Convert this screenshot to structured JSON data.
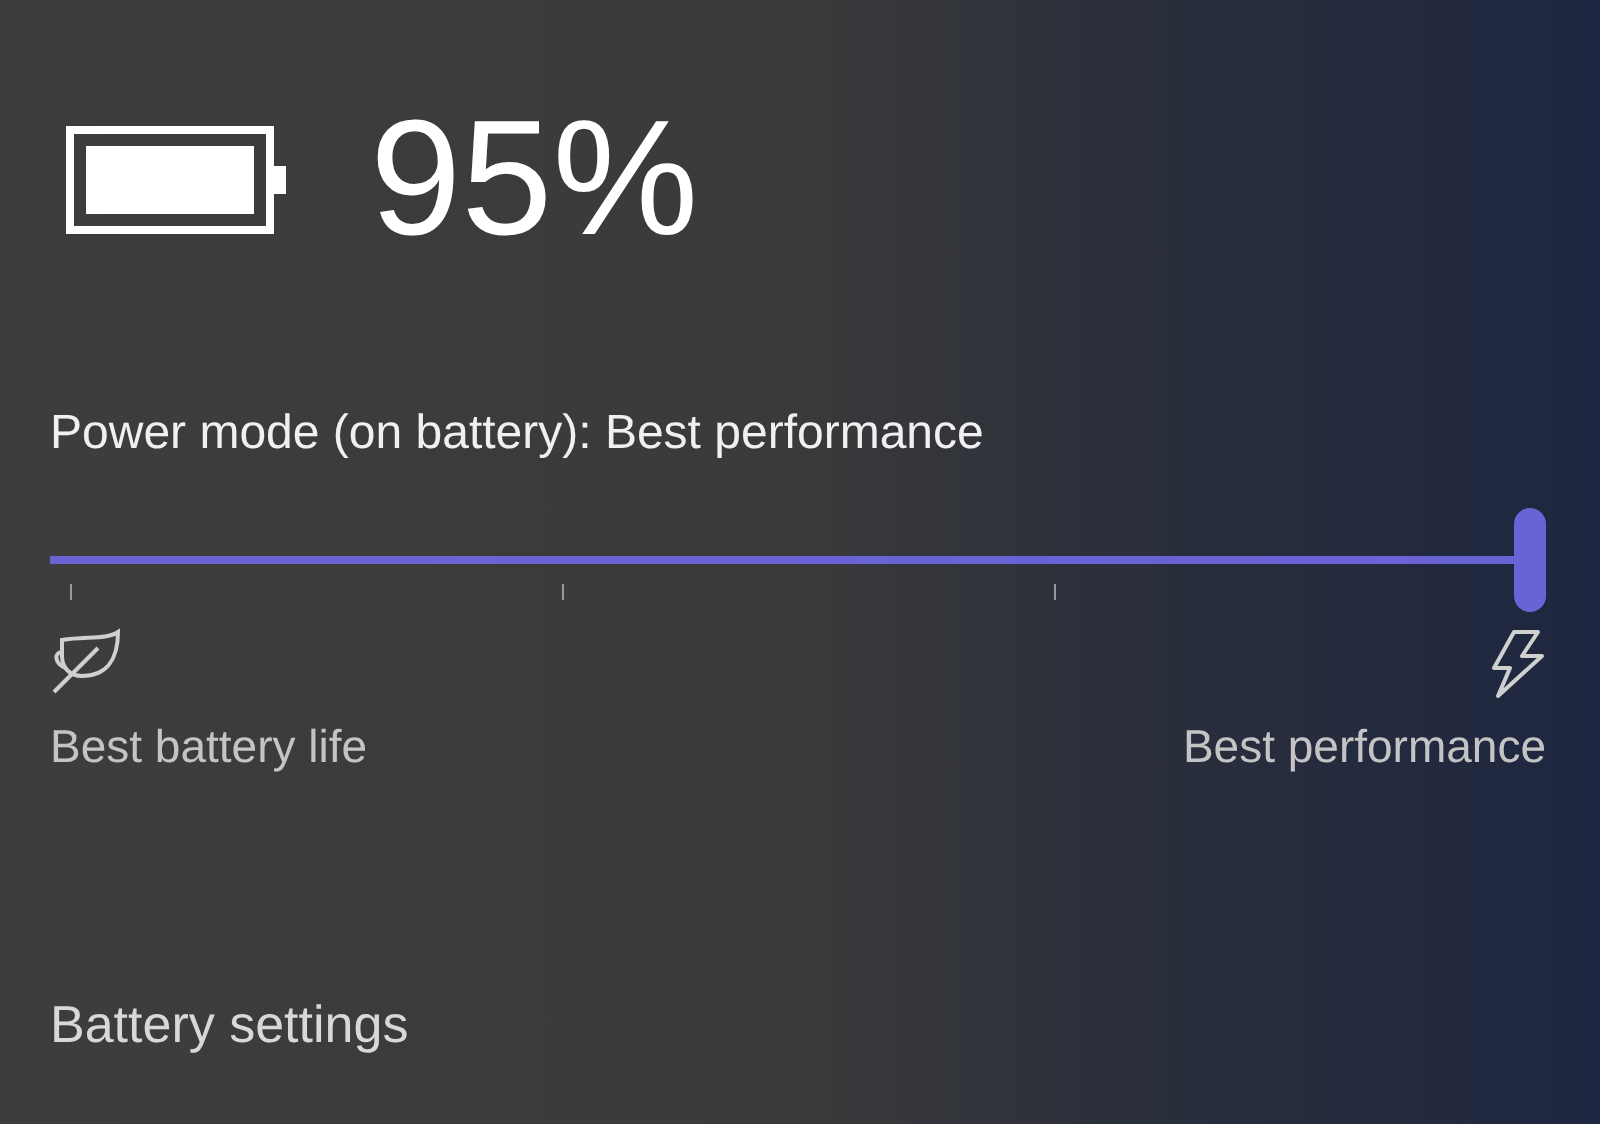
{
  "battery": {
    "percent": "95%"
  },
  "power_mode": {
    "label": "Power mode (on battery): Best performance",
    "level": 1,
    "min_label": "Best battery life",
    "max_label": "Best performance"
  },
  "link": "Battery settings"
}
